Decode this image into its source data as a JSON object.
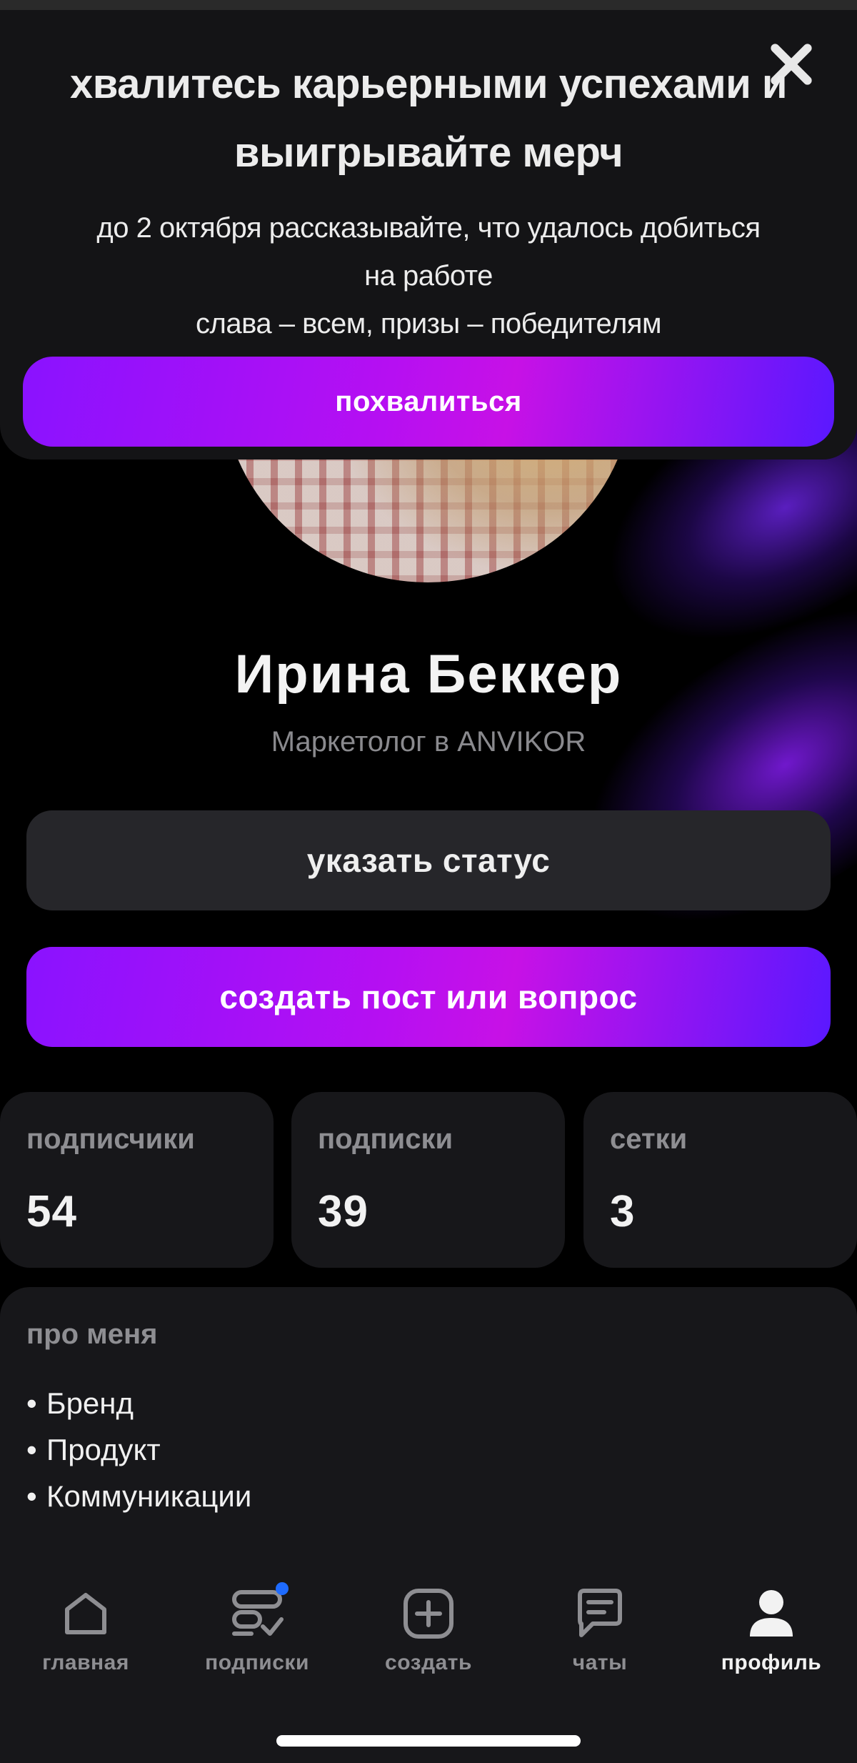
{
  "promo": {
    "title": "хвалитесь карьерными успехами и выигрывайте мерч",
    "text_lines": [
      "до 2 октября рассказывайте, что удалось добиться",
      "на работе",
      "слава – всем, призы – победителям"
    ],
    "button": "похвалиться",
    "close_icon": "close-icon"
  },
  "profile": {
    "name": "Ирина Беккер",
    "job": "Маркетолог в ANVIKOR",
    "status_button": "указать статус",
    "create_button": "создать пост или вопрос"
  },
  "stats": [
    {
      "label": "подписчики",
      "value": "54"
    },
    {
      "label": "подписки",
      "value": "39"
    },
    {
      "label": "сетки",
      "value": "3"
    }
  ],
  "about": {
    "header": "про меня",
    "bullet": "•",
    "items": [
      "Бренд",
      "Продукт",
      "Коммуникации"
    ]
  },
  "tabbar": [
    {
      "label": "главная",
      "icon": "home-icon",
      "active": false
    },
    {
      "label": "подписки",
      "icon": "subscriptions-icon",
      "active": false,
      "badge": true
    },
    {
      "label": "создать",
      "icon": "plus-square-icon",
      "active": false
    },
    {
      "label": "чаты",
      "icon": "chat-icon",
      "active": false
    },
    {
      "label": "профиль",
      "icon": "profile-icon",
      "active": true
    }
  ],
  "colors": {
    "accent_gradient_start": "#8a12ff",
    "accent_gradient_mid": "#c711e6",
    "accent_gradient_end": "#5a18ff",
    "badge": "#1e6bff"
  }
}
